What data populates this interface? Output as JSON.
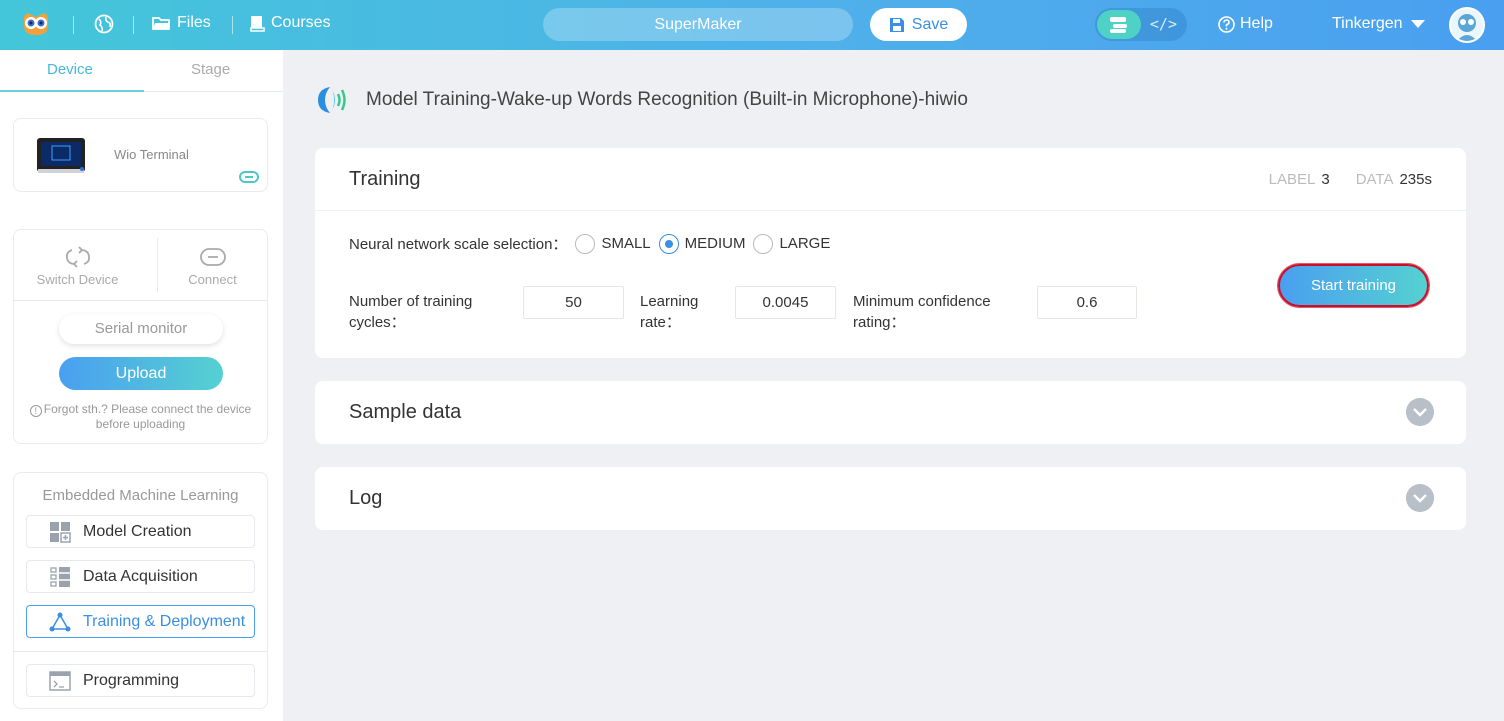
{
  "topbar": {
    "files_label": "Files",
    "courses_label": "Courses",
    "project_name": "SuperMaker",
    "save_label": "Save",
    "code_toggle_label": "</>",
    "help_label": "Help",
    "user_name": "Tinkergen"
  },
  "sidebar": {
    "tabs": [
      {
        "label": "Device",
        "active": true
      },
      {
        "label": "Stage",
        "active": false
      }
    ],
    "device": {
      "name": "Wio Terminal"
    },
    "actions": {
      "switch_device": "Switch Device",
      "connect": "Connect",
      "serial_monitor": "Serial monitor",
      "upload": "Upload",
      "hint": "Forgot sth.? Please connect the device before uploading"
    },
    "ml": {
      "title": "Embedded Machine Learning",
      "items": [
        {
          "label": "Model Creation",
          "icon": "grid-plus-icon",
          "active": false
        },
        {
          "label": "Data Acquisition",
          "icon": "list-icon",
          "active": false
        },
        {
          "label": "Training & Deployment",
          "icon": "network-triangle-icon",
          "active": true
        },
        {
          "label": "Programming",
          "icon": "terminal-icon",
          "active": false
        }
      ]
    }
  },
  "main": {
    "page_title": "Model Training-Wake-up Words Recognition (Built-in Microphone)-hiwio",
    "training": {
      "title": "Training",
      "stats": {
        "label_key": "LABEL",
        "label_value": "3",
        "data_key": "DATA",
        "data_value": "235s"
      },
      "nn_label": "Neural network scale selection：",
      "nn_options": [
        {
          "label": "SMALL",
          "checked": false
        },
        {
          "label": "MEDIUM",
          "checked": true
        },
        {
          "label": "LARGE",
          "checked": false
        }
      ],
      "params": {
        "cycles_label_1": "Number of training",
        "cycles_label_2": "cycles：",
        "cycles_value": "50",
        "lr_label_1": "Learning",
        "lr_label_2": "rate：",
        "lr_value": "0.0045",
        "conf_label_1": "Minimum confidence",
        "conf_label_2": "rating：",
        "conf_value": "0.6"
      },
      "start_label": "Start training"
    },
    "sample_data": {
      "title": "Sample data"
    },
    "log": {
      "title": "Log"
    }
  },
  "colors": {
    "accent": "#3a8ee6",
    "teal": "#55d1d1",
    "highlight_border": "#c8102e"
  }
}
